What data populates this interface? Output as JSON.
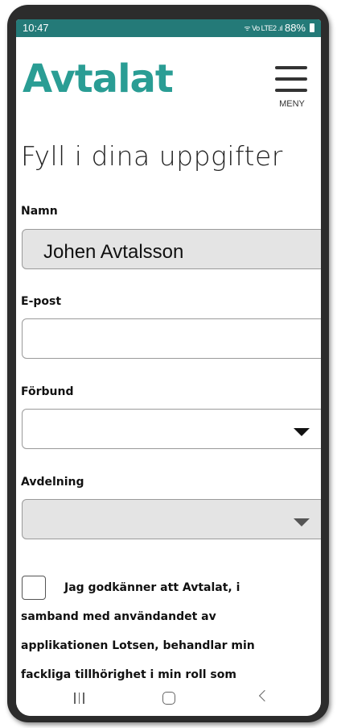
{
  "status_bar": {
    "time": "10:47",
    "icons": "ᯤ Vo LTE2 .ıl",
    "battery": "88%"
  },
  "header": {
    "logo_text": "Avtalat",
    "menu_label": "MENY"
  },
  "page": {
    "title": "Fyll i dina uppgifter"
  },
  "form": {
    "name": {
      "label": "Namn",
      "value": "Johen Avtalsson"
    },
    "email": {
      "label": "E-post",
      "value": ""
    },
    "union": {
      "label": "Förbund",
      "selected": ""
    },
    "department": {
      "label": "Avdelning",
      "selected": ""
    },
    "consent": {
      "line1": "Jag godkänner att Avtalat, i",
      "line2": "samband med användandet av",
      "line3": "applikationen Lotsen, behandlar min",
      "line4": "fackliga tillhörighet i min roll som"
    }
  },
  "colors": {
    "brand": "#2a9d94",
    "status_bar": "#247a78"
  },
  "icons": {
    "menu": "hamburger-icon",
    "dropdown": "caret-down-icon",
    "nav_recent": "recent-apps-icon",
    "nav_home": "home-icon",
    "nav_back": "back-icon"
  }
}
